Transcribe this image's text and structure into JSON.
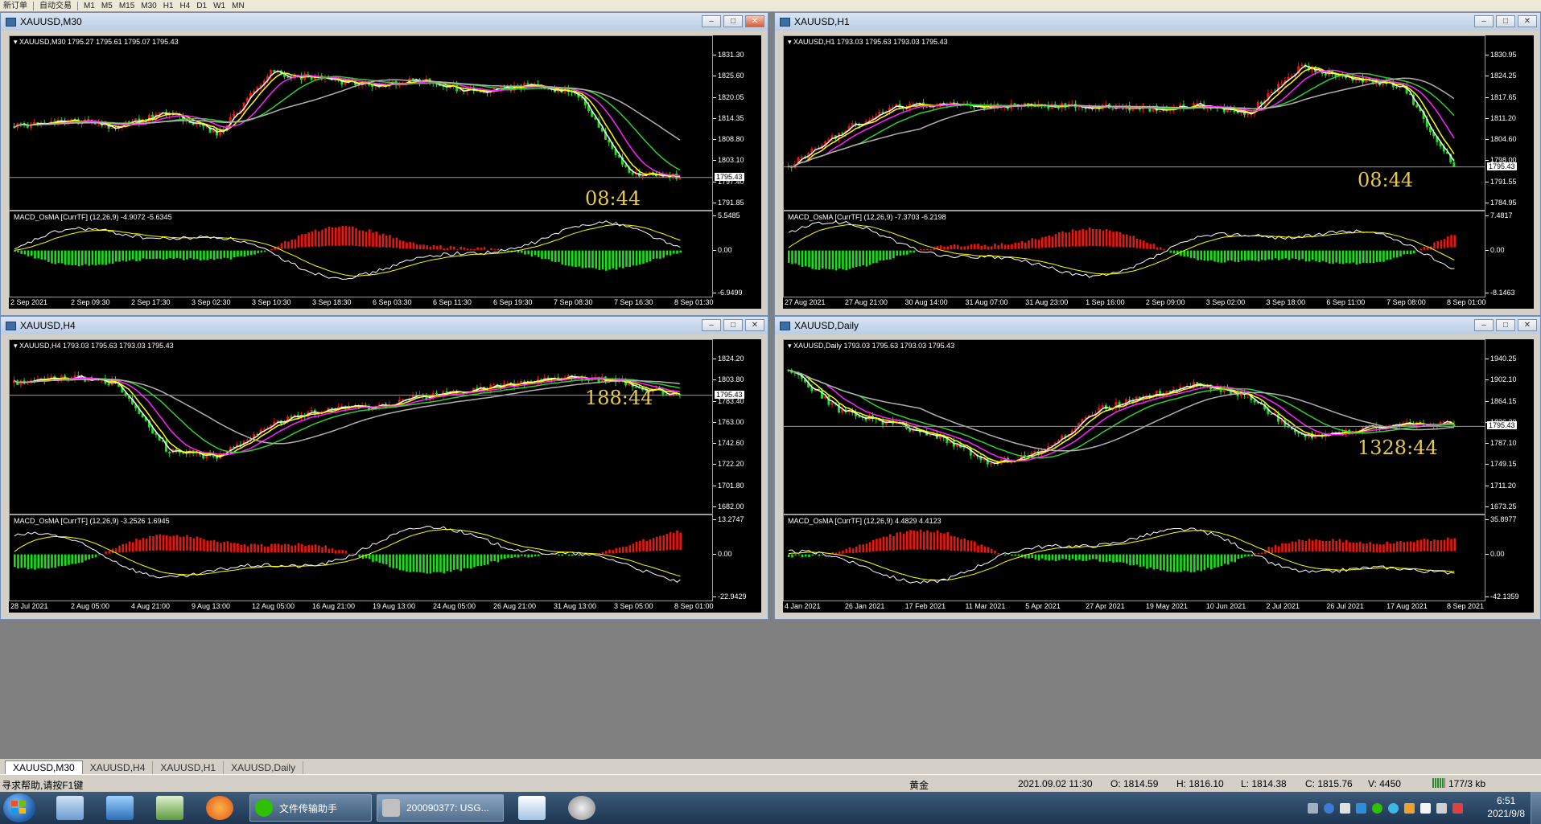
{
  "toolbar": {
    "items": [
      "新订单",
      "自动交易",
      "M1",
      "M5",
      "M15",
      "M30",
      "H1",
      "H4",
      "D1",
      "W1",
      "MN"
    ]
  },
  "windows": [
    {
      "title": "XAUUSD,M30",
      "ohlc_label": "XAUUSD,M30  1795.27 1795.61 1795.07 1795.43",
      "indicator_label": "MACD_OsMA [CurrTF] (12,26,9) -4.9072 -5.6345",
      "timer": "08:44",
      "price_ticks": [
        "1831.30",
        "1825.60",
        "1820.05",
        "1814.35",
        "1808.80",
        "1803.10",
        "1797.40",
        "1791.85"
      ],
      "current_price": "1795.43",
      "ind_ticks": [
        "5.5485",
        "0.00",
        "-6.9499"
      ],
      "time_ticks": [
        "2 Sep 2021",
        "2 Sep 09:30",
        "2 Sep 17:30",
        "3 Sep 02:30",
        "3 Sep 10:30",
        "3 Sep 18:30",
        "6 Sep 03:30",
        "6 Sep 11:30",
        "6 Sep 19:30",
        "7 Sep 08:30",
        "7 Sep 16:30",
        "8 Sep 01:30"
      ]
    },
    {
      "title": "XAUUSD,H1",
      "ohlc_label": "XAUUSD,H1  1793.03 1795.63 1793.03 1795.43",
      "indicator_label": "MACD_OsMA [CurrTF] (12,26,9) -7.3703 -6.2198",
      "timer": "08:44",
      "price_ticks": [
        "1830.95",
        "1824.25",
        "1817.65",
        "1811.20",
        "1804.60",
        "1798.00",
        "1791.55",
        "1784.95"
      ],
      "current_price": "1795.43",
      "ind_ticks": [
        "7.4817",
        "0.00",
        "-8.1463"
      ],
      "time_ticks": [
        "27 Aug 2021",
        "27 Aug 21:00",
        "30 Aug 14:00",
        "31 Aug 07:00",
        "31 Aug 23:00",
        "1 Sep 16:00",
        "2 Sep 09:00",
        "3 Sep 02:00",
        "3 Sep 18:00",
        "6 Sep 11:00",
        "7 Sep 08:00",
        "8 Sep 01:00"
      ]
    },
    {
      "title": "XAUUSD,H4",
      "ohlc_label": "XAUUSD,H4  1793.03 1795.63 1793.03 1795.43",
      "indicator_label": "MACD_OsMA [CurrTF] (12,26,9) -3.2526 1.6945",
      "timer": "188:44",
      "price_ticks": [
        "1824.20",
        "1803.80",
        "1783.40",
        "1763.00",
        "1742.60",
        "1722.20",
        "1701.80",
        "1682.00"
      ],
      "current_price": "1795.43",
      "ind_ticks": [
        "13.2747",
        "0.00",
        "-22.9429"
      ],
      "time_ticks": [
        "28 Jul 2021",
        "2 Aug 05:00",
        "4 Aug 21:00",
        "9 Aug 13:00",
        "12 Aug 05:00",
        "16 Aug 21:00",
        "19 Aug 13:00",
        "24 Aug 05:00",
        "26 Aug 21:00",
        "31 Aug 13:00",
        "3 Sep 05:00",
        "8 Sep 01:00"
      ]
    },
    {
      "title": "XAUUSD,Daily",
      "ohlc_label": "XAUUSD,Daily  1793.03 1795.63 1793.03 1795.43",
      "indicator_label": "MACD_OsMA [CurrTF] (12,26,9) 4.4829 4.4123",
      "timer": "1328:44",
      "price_ticks": [
        "1940.25",
        "1902.10",
        "1864.15",
        "1826.20",
        "1787.10",
        "1749.15",
        "1711.20",
        "1673.25"
      ],
      "current_price": "1795.43",
      "ind_ticks": [
        "35.8977",
        "0.00",
        "-42.1359"
      ],
      "time_ticks": [
        "4 Jan 2021",
        "26 Jan 2021",
        "17 Feb 2021",
        "11 Mar 2021",
        "5 Apr 2021",
        "27 Apr 2021",
        "19 May 2021",
        "10 Jun 2021",
        "2 Jul 2021",
        "26 Jul 2021",
        "17 Aug 2021",
        "8 Sep 2021"
      ]
    }
  ],
  "tabs": [
    "XAUUSD,M30",
    "XAUUSD,H4",
    "XAUUSD,H1",
    "XAUUSD,Daily"
  ],
  "status": {
    "help": "寻求帮助,请按F1键",
    "symbol": "黄金",
    "datetime": "2021.09.02 11:30",
    "open": "O: 1814.59",
    "high": "H: 1816.10",
    "low": "L: 1814.38",
    "close": "C: 1815.76",
    "volume": "V: 4450",
    "traffic": "177/3 kb"
  },
  "taskbar": {
    "buttons": [
      "文件传输助手",
      "200090377: USG..."
    ],
    "time": "6:51",
    "date": "2021/9/8"
  },
  "colors": {
    "bull": "#e8160c",
    "bear": "#16e01a",
    "ma_white": "#ffffff",
    "ma_yellow": "#ffff00",
    "ma_magenta": "#ff22ff",
    "ma_green": "#32cd32",
    "ma_gray": "#b0b0b0",
    "timer": "#e6c84a"
  }
}
